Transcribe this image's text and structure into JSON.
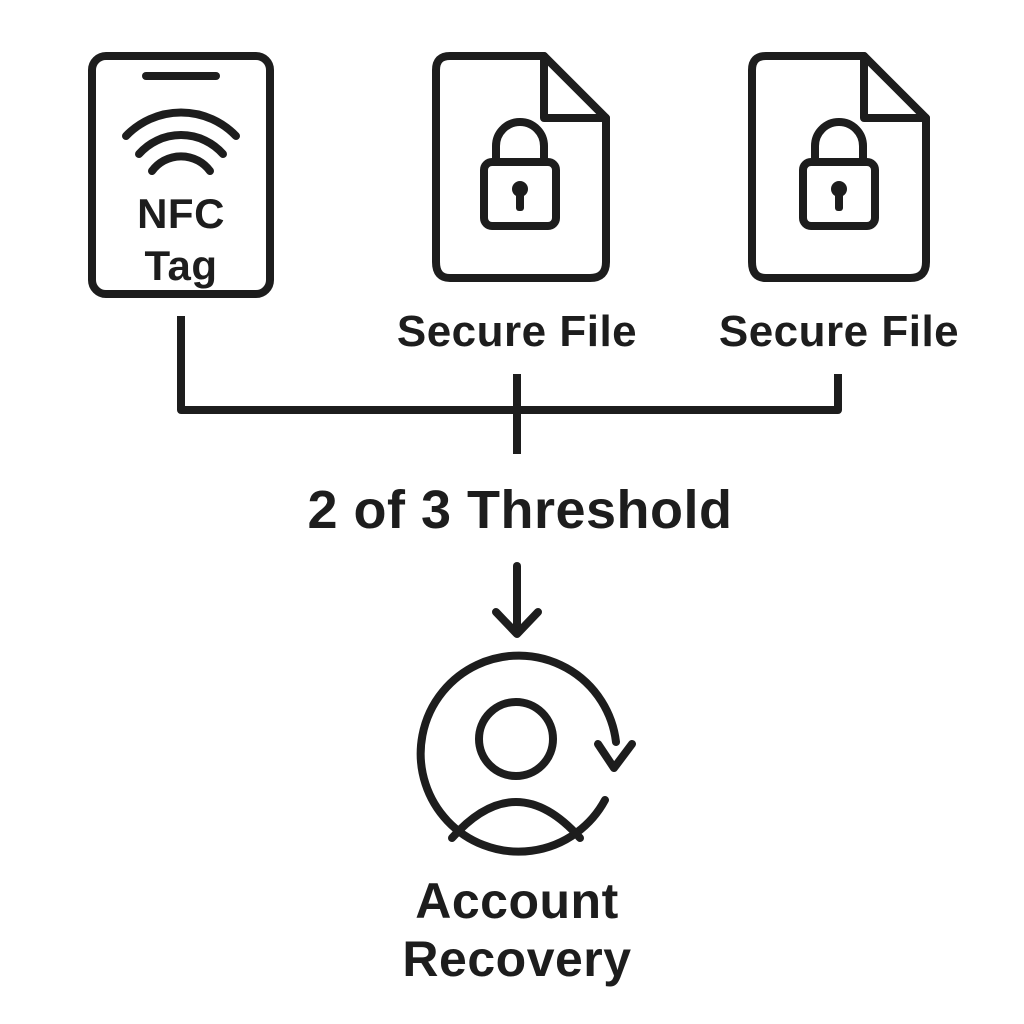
{
  "diagram": {
    "nfc_tag": {
      "label_line1": "NFC",
      "label_line2": "Tag",
      "icon": "nfc-wave-icon"
    },
    "secure_file_1": {
      "label": "Secure File",
      "icon": "padlock-icon"
    },
    "secure_file_2": {
      "label": "Secure File",
      "icon": "padlock-icon"
    },
    "threshold": {
      "label": "2 of 3 Threshold"
    },
    "arrow_icon": "arrow-down-icon",
    "account_recovery": {
      "label_line1": "Account",
      "label_line2": "Recovery",
      "icon": "user-recovery-icon"
    },
    "colors": {
      "stroke": "#1d1d1d",
      "background": "#ffffff"
    }
  }
}
